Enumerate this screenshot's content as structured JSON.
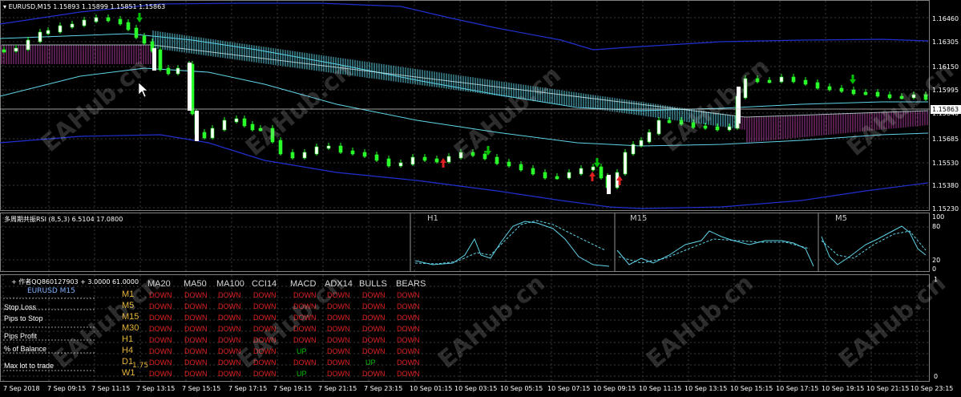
{
  "chart_header": {
    "symbol_tf": "EURUSD,M15",
    "ohlc": "1.15893 1.15899 1.15851 1.15863"
  },
  "price_axis": [
    "1.16460",
    "1.16305",
    "1.16150",
    "1.15995",
    "1.15840",
    "1.15685",
    "1.15530",
    "1.15380",
    "1.15230"
  ],
  "current_price": "1.15863",
  "rsi_panel": {
    "title": "多周期共振RSI (8,5,3) 6.5104 17.0800",
    "tf_labels": [
      "H1",
      "M15",
      "M5"
    ],
    "levels": [
      "100",
      "80",
      "20",
      "0"
    ]
  },
  "dashboard": {
    "title": "+ 作者QQ860127903 + 3.0000 61.0000",
    "symbol": "EURUSD  M15",
    "side_labels": [
      "Stop Loss",
      "Pips to Stop",
      "Pips Profit",
      "% of Balance",
      "Max lot to trade"
    ],
    "overlay_value": "1.75",
    "columns": [
      "MA20",
      "MA50",
      "MA100",
      "CCI14",
      "MACD",
      "ADX14",
      "BULLS",
      "BEARS"
    ],
    "rows": [
      {
        "tf": "M1",
        "cells": [
          "DOWN",
          "DOWN",
          "DOWN",
          "DOWN",
          "DOWN",
          "DOWN",
          "DOWN",
          "DOWN"
        ]
      },
      {
        "tf": "M5",
        "cells": [
          "DOWN",
          "DOWN",
          "DOWN",
          "DOWN",
          "DOWN",
          "DOWN",
          "DOWN",
          "DOWN"
        ]
      },
      {
        "tf": "M15",
        "cells": [
          "DOWN",
          "DOWN",
          "DOWN",
          "DOWN",
          "DOWN",
          "DOWN",
          "DOWN",
          "DOWN"
        ]
      },
      {
        "tf": "M30",
        "cells": [
          "DOWN",
          "DOWN",
          "DOWN",
          "DOWN",
          "DOWN",
          "DOWN",
          "DOWN",
          "DOWN"
        ]
      },
      {
        "tf": "H1",
        "cells": [
          "DOWN",
          "DOWN",
          "DOWN",
          "DOWN",
          "DOWN",
          "DOWN",
          "DOWN",
          "DOWN"
        ]
      },
      {
        "tf": "H4",
        "cells": [
          "DOWN",
          "DOWN",
          "DOWN",
          "DOWN",
          "UP",
          "DOWN",
          "DOWN",
          "DOWN"
        ]
      },
      {
        "tf": "D1",
        "cells": [
          "DOWN",
          "DOWN",
          "DOWN",
          "DOWN",
          "DOWN",
          "DOWN",
          "UP",
          "DOWN"
        ]
      },
      {
        "tf": "W1",
        "cells": [
          "DOWN",
          "DOWN",
          "DOWN",
          "DOWN",
          "UP",
          "DOWN",
          "DOWN",
          "DOWN"
        ]
      }
    ],
    "scale": [
      "1",
      "0"
    ]
  },
  "time_axis": [
    "7 Sep 2018",
    "7 Sep 09:15",
    "7 Sep 11:15",
    "7 Sep 13:15",
    "7 Sep 15:15",
    "7 Sep 17:15",
    "7 Sep 19:15",
    "7 Sep 21:15",
    "7 Sep 23:15",
    "10 Sep 01:15",
    "10 Sep 03:15",
    "10 Sep 05:15",
    "10 Sep 07:15",
    "10 Sep 09:15",
    "10 Sep 11:15",
    "10 Sep 13:15",
    "10 Sep 15:15",
    "10 Sep 17:15",
    "10 Sep 19:15",
    "10 Sep 21:15",
    "10 Sep 23:15"
  ],
  "watermark": "EAHub.cn",
  "colors": {
    "up": "#00c000",
    "down": "#e02020",
    "band": "#5fd3e8",
    "band_alt": "#b040a0",
    "envelope": "#2030d0",
    "candle": "#2aff2a",
    "grid": "#3a3a3a"
  }
}
